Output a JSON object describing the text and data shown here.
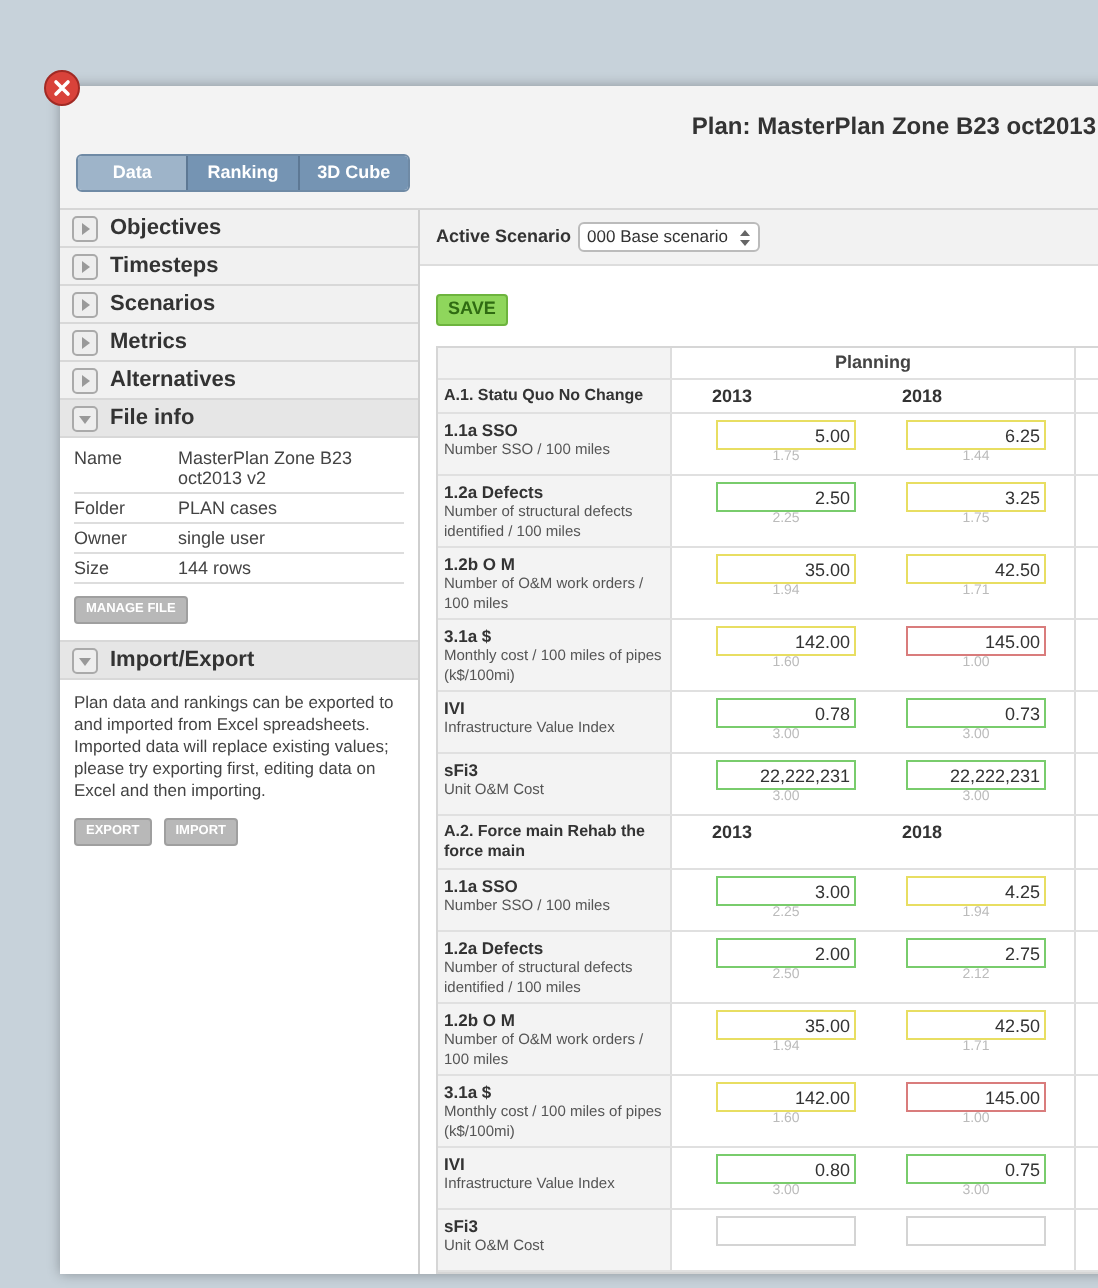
{
  "window": {
    "title": "Plan: MasterPlan Zone B23 oct2013"
  },
  "tabs": [
    {
      "label": "Data",
      "selected": true
    },
    {
      "label": "Ranking",
      "selected": false
    },
    {
      "label": "3D Cube",
      "selected": false
    }
  ],
  "sidebar": {
    "sections": [
      {
        "label": "Objectives",
        "expanded": false
      },
      {
        "label": "Timesteps",
        "expanded": false
      },
      {
        "label": "Scenarios",
        "expanded": false
      },
      {
        "label": "Metrics",
        "expanded": false
      },
      {
        "label": "Alternatives",
        "expanded": false
      },
      {
        "label": "File info",
        "expanded": true,
        "kind": "file_info",
        "rows": [
          {
            "key": "Name",
            "value": "MasterPlan Zone B23 oct2013 v2"
          },
          {
            "key": "Folder",
            "value": "PLAN cases"
          },
          {
            "key": "Owner",
            "value": "single user"
          },
          {
            "key": "Size",
            "value": "144 rows"
          }
        ],
        "buttons": [
          "MANAGE FILE"
        ]
      },
      {
        "label": "Import/Export",
        "expanded": true,
        "kind": "text",
        "text": "Plan data and rankings can be exported to and imported from Excel spreadsheets. Imported data will replace existing values; please try exporting first, editing data on Excel and then importing.",
        "buttons": [
          "EXPORT",
          "IMPORT"
        ]
      }
    ]
  },
  "active_scenario": {
    "label": "Active Scenario",
    "value": "000 Base scenario"
  },
  "save_button": "SAVE",
  "table": {
    "group_header": "Planning",
    "groups": [
      {
        "title": "A.1. Statu Quo No Change",
        "years": [
          "2013",
          "2018"
        ],
        "rows": [
          {
            "name": "1.1a SSO",
            "description": "Number SSO / 100 miles",
            "cells": [
              {
                "value": "5.00",
                "reference": "1.75",
                "color": "#e8de62"
              },
              {
                "value": "6.25",
                "reference": "1.44",
                "color": "#e8de62"
              }
            ]
          },
          {
            "name": "1.2a Defects",
            "description": "Number of structural defects identified / 100 miles",
            "cells": [
              {
                "value": "2.50",
                "reference": "2.25",
                "color": "#79cc6c"
              },
              {
                "value": "3.25",
                "reference": "1.75",
                "color": "#e8de62"
              }
            ]
          },
          {
            "name": "1.2b O M",
            "description": "Number of O&M work orders / 100 miles",
            "cells": [
              {
                "value": "35.00",
                "reference": "1.94",
                "color": "#e8de62"
              },
              {
                "value": "42.50",
                "reference": "1.71",
                "color": "#e8de62"
              }
            ]
          },
          {
            "name": "3.1a $",
            "description": "Monthly cost / 100 miles of pipes (k$/100mi)",
            "cells": [
              {
                "value": "142.00",
                "reference": "1.60",
                "color": "#e8de62"
              },
              {
                "value": "145.00",
                "reference": "1.00",
                "color": "#d97c7c"
              }
            ]
          },
          {
            "name": "IVI",
            "description": "Infrastructure Value Index",
            "cells": [
              {
                "value": "0.78",
                "reference": "3.00",
                "color": "#79cc6c"
              },
              {
                "value": "0.73",
                "reference": "3.00",
                "color": "#79cc6c"
              }
            ]
          },
          {
            "name": "sFi3",
            "description": "Unit O&M Cost",
            "cells": [
              {
                "value": "22,222,231",
                "reference": "3.00",
                "color": "#79cc6c"
              },
              {
                "value": "22,222,231",
                "reference": "3.00",
                "color": "#79cc6c"
              }
            ]
          }
        ]
      },
      {
        "title": "A.2. Force main Rehab the force main",
        "years": [
          "2013",
          "2018"
        ],
        "rows": [
          {
            "name": "1.1a SSO",
            "description": "Number SSO / 100 miles",
            "cells": [
              {
                "value": "3.00",
                "reference": "2.25",
                "color": "#79cc6c"
              },
              {
                "value": "4.25",
                "reference": "1.94",
                "color": "#e8de62"
              }
            ]
          },
          {
            "name": "1.2a Defects",
            "description": "Number of structural defects identified / 100 miles",
            "cells": [
              {
                "value": "2.00",
                "reference": "2.50",
                "color": "#79cc6c"
              },
              {
                "value": "2.75",
                "reference": "2.12",
                "color": "#79cc6c"
              }
            ]
          },
          {
            "name": "1.2b O M",
            "description": "Number of O&M work orders / 100 miles",
            "cells": [
              {
                "value": "35.00",
                "reference": "1.94",
                "color": "#e8de62"
              },
              {
                "value": "42.50",
                "reference": "1.71",
                "color": "#e8de62"
              }
            ]
          },
          {
            "name": "3.1a $",
            "description": "Monthly cost / 100 miles of pipes (k$/100mi)",
            "cells": [
              {
                "value": "142.00",
                "reference": "1.60",
                "color": "#e8de62"
              },
              {
                "value": "145.00",
                "reference": "1.00",
                "color": "#d97c7c"
              }
            ]
          },
          {
            "name": "IVI",
            "description": "Infrastructure Value Index",
            "cells": [
              {
                "value": "0.80",
                "reference": "3.00",
                "color": "#79cc6c"
              },
              {
                "value": "0.75",
                "reference": "3.00",
                "color": "#79cc6c"
              }
            ]
          },
          {
            "name": "sFi3",
            "description": "Unit O&M Cost",
            "cells": [
              {
                "color": "#d4d4d4"
              },
              {
                "color": "#d4d4d4"
              }
            ]
          }
        ]
      }
    ]
  }
}
